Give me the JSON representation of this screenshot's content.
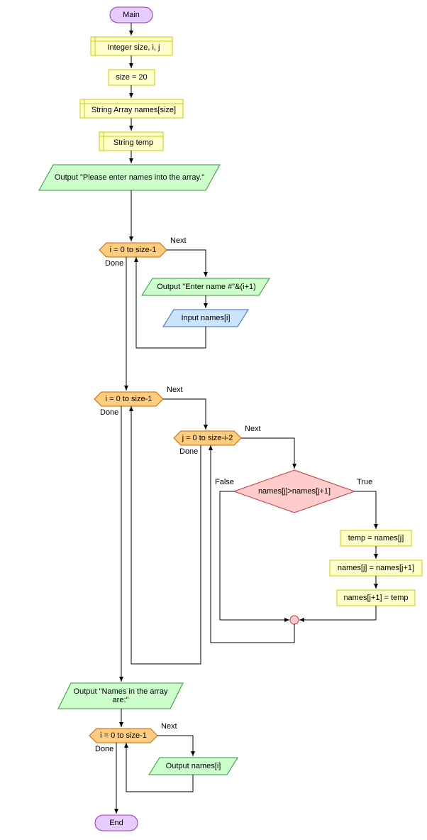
{
  "chart_data": {
    "type": "flowchart",
    "nodes": [
      {
        "id": "main",
        "shape": "terminal",
        "text": "Main"
      },
      {
        "id": "decl1",
        "shape": "declaration",
        "text": "Integer size, i, j"
      },
      {
        "id": "assign1",
        "shape": "process",
        "text": "size = 20"
      },
      {
        "id": "decl2",
        "shape": "declaration",
        "text": "String Array names[size]"
      },
      {
        "id": "decl3",
        "shape": "declaration",
        "text": "String temp"
      },
      {
        "id": "out1",
        "shape": "io",
        "text": "Output \"Please enter names into the array.\""
      },
      {
        "id": "loop1",
        "shape": "loop",
        "text": "i = 0 to size-1"
      },
      {
        "id": "out2",
        "shape": "io",
        "text": "Output \"Enter name #\"&(i+1)"
      },
      {
        "id": "in1",
        "shape": "io",
        "text": "Input names[i]"
      },
      {
        "id": "loop2",
        "shape": "loop",
        "text": "i = 0 to size-1"
      },
      {
        "id": "loop3",
        "shape": "loop",
        "text": "j = 0 to size-i-2"
      },
      {
        "id": "dec1",
        "shape": "decision",
        "text": "names[j]>names[j+1]"
      },
      {
        "id": "assign2",
        "shape": "process",
        "text": "temp = names[j]"
      },
      {
        "id": "assign3",
        "shape": "process",
        "text": "names[j] = names[j+1]"
      },
      {
        "id": "assign4",
        "shape": "process",
        "text": "names[j+1] = temp"
      },
      {
        "id": "join1",
        "shape": "connector",
        "text": ""
      },
      {
        "id": "out3",
        "shape": "io",
        "text": "Output \"Names in the array are:\""
      },
      {
        "id": "loop4",
        "shape": "loop",
        "text": "i = 0 to size-1"
      },
      {
        "id": "out4",
        "shape": "io",
        "text": "Output names[i]"
      },
      {
        "id": "end",
        "shape": "terminal",
        "text": "End"
      }
    ],
    "edges": [
      {
        "from": "main",
        "to": "decl1"
      },
      {
        "from": "decl1",
        "to": "assign1"
      },
      {
        "from": "assign1",
        "to": "decl2"
      },
      {
        "from": "decl2",
        "to": "decl3"
      },
      {
        "from": "decl3",
        "to": "out1"
      },
      {
        "from": "out1",
        "to": "loop1"
      },
      {
        "from": "loop1",
        "to": "out2",
        "label": "Next"
      },
      {
        "from": "out2",
        "to": "in1"
      },
      {
        "from": "in1",
        "to": "loop1"
      },
      {
        "from": "loop1",
        "to": "loop2",
        "label": "Done"
      },
      {
        "from": "loop2",
        "to": "loop3",
        "label": "Next"
      },
      {
        "from": "loop3",
        "to": "dec1",
        "label": "Next"
      },
      {
        "from": "dec1",
        "to": "assign2",
        "label": "True"
      },
      {
        "from": "assign2",
        "to": "assign3"
      },
      {
        "from": "assign3",
        "to": "assign4"
      },
      {
        "from": "assign4",
        "to": "join1"
      },
      {
        "from": "dec1",
        "to": "join1",
        "label": "False"
      },
      {
        "from": "join1",
        "to": "loop3"
      },
      {
        "from": "loop3",
        "to": "loop2",
        "label": "Done"
      },
      {
        "from": "loop2",
        "to": "out3",
        "label": "Done"
      },
      {
        "from": "out3",
        "to": "loop4"
      },
      {
        "from": "loop4",
        "to": "out4",
        "label": "Next"
      },
      {
        "from": "out4",
        "to": "loop4"
      },
      {
        "from": "loop4",
        "to": "end",
        "label": "Done"
      }
    ]
  },
  "labels": {
    "next": "Next",
    "done": "Done",
    "true": "True",
    "false": "False"
  },
  "nodes": {
    "main": "Main",
    "decl1": "Integer size, i, j",
    "assign1": "size = 20",
    "decl2": "String Array names[size]",
    "decl3": "String temp",
    "out1": "Output \"Please enter names into the array.\"",
    "loop1": "i = 0 to size-1",
    "out2": "Output \"Enter name #\"&(i+1)",
    "in1": "Input names[i]",
    "loop2": "i = 0 to size-1",
    "loop3": "j = 0 to size-i-2",
    "dec1": "names[j]>names[j+1]",
    "assign2": "temp = names[j]",
    "assign3": "names[j] = names[j+1]",
    "assign4": "names[j+1] = temp",
    "out3": "Output \"Names in the array are:\"",
    "loop4": "i = 0 to size-1",
    "out4": "Output names[i]",
    "end": "End"
  }
}
